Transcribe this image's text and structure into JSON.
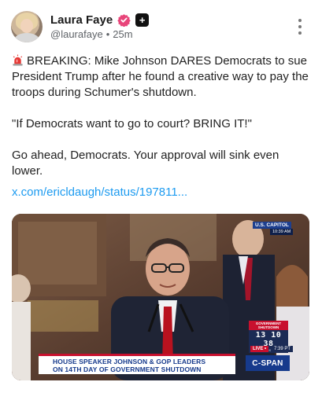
{
  "author": {
    "display_name": "Laura Faye",
    "handle": "@laurafaye",
    "separator": "•",
    "time_ago": "25m"
  },
  "post": {
    "breaking_text": "BREAKING: Mike Johnson DARES Democrats to sue President Trump after he found a creative way to pay the troops during Schumer's shutdown.",
    "quote_text": "\"If Democrats want to go to court? BRING IT!\"",
    "closing_text": "Go ahead, Democrats. Your approval will sink even lower.",
    "link_text": "x.com/ericldaugh/status/197811..."
  },
  "media": {
    "chyron_line1": "HOUSE SPEAKER JOHNSON & GOP LEADERS",
    "chyron_line2": "ON 14TH DAY OF GOVERNMENT SHUTDOWN",
    "network": "C-SPAN",
    "location": "U.S. CAPITOL",
    "location_time": "10:39 AM",
    "shutdown_label": "GOVERNMENT SHUTDOWN",
    "shutdown_clock": "13 10 38",
    "shutdown_units": "DAYS HOURS MINUTES",
    "live_label": "LIVE •",
    "live_time": "7:39 PT"
  },
  "icons": {
    "verified": "verified-badge-icon",
    "plus": "plus-badge-icon",
    "more": "more-vertical-icon",
    "siren": "siren-icon"
  },
  "colors": {
    "link": "#1d9bf0",
    "verified": "#e8457a",
    "chyron_text": "#163a8c",
    "alert_red": "#c8102e"
  }
}
